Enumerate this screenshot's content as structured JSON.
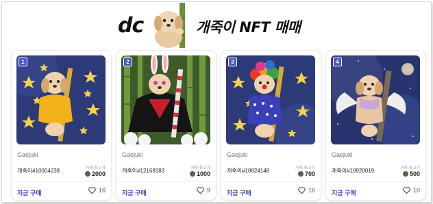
{
  "header": {
    "logo_text": "dc",
    "title": "개죽이 NFT 매매",
    "mascot_icon": "puppy-with-bamboo"
  },
  "colors": {
    "accent": "#3d48b8",
    "badge": "#4b56c9"
  },
  "cards": [
    {
      "number": "1",
      "art_icon": "puppy-yellow-shirt-bamboo-stars",
      "collection": "Gaejuki",
      "token": "개죽이#10004238",
      "price_label": "거래 최고가",
      "price": "2000",
      "buy_label": "지금 구매",
      "likes": "16"
    },
    {
      "number": "2",
      "art_icon": "puppy-bunny-ears-cape-bamboo-forest",
      "collection": "Gaejuki",
      "token": "개죽이#12168183",
      "price_label": "거래 최고가",
      "price": "1000",
      "buy_label": "지금 구매",
      "likes": "9"
    },
    {
      "number": "3",
      "art_icon": "puppy-clown-wig-stars",
      "collection": "Gaejuki",
      "token": "개죽이#10824148",
      "price_label": "거래 최고가",
      "price": "700",
      "buy_label": "지금 구매",
      "likes": "16"
    },
    {
      "number": "4",
      "art_icon": "puppy-angel-wings-space",
      "collection": "Gaejuki",
      "token": "개죽이#10920019",
      "price_label": "거래 최고가",
      "price": "500",
      "buy_label": "지금 구매",
      "likes": "10"
    }
  ]
}
